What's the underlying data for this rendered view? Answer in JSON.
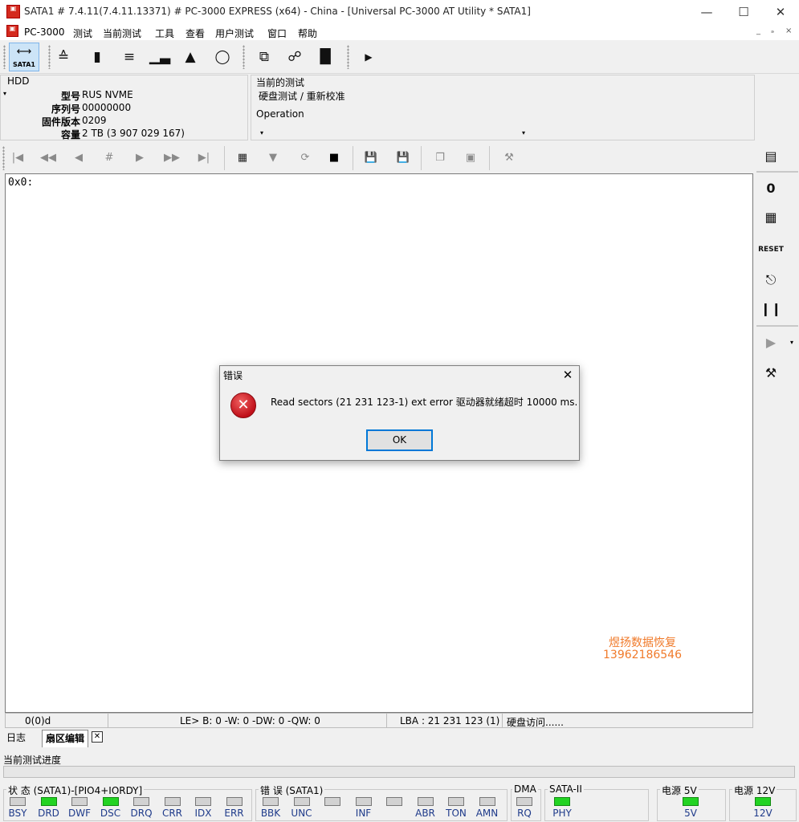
{
  "window": {
    "title": "SATA1 # 7.4.11(7.4.11.13371) # PC-3000 EXPRESS (x64) - China - [Universal PC-3000 AT Utility * SATA1]",
    "minimize": "—",
    "maximize": "☐",
    "close": "✕"
  },
  "menu": {
    "items": [
      "PC-3000",
      "测试",
      "当前测试",
      "工具",
      "查看",
      "用户测试",
      "窗口",
      "帮助"
    ],
    "mdi_min": "_",
    "mdi_restore": "ₔ",
    "mdi_close": "×"
  },
  "toolbar": {
    "sata_label": "SATA1",
    "more": "▶"
  },
  "hdd": {
    "group": "HDD",
    "model_label": "型号",
    "model": "RUS NVME",
    "serial_label": "序列号",
    "serial": "00000000",
    "firmware_label": "固件版本",
    "firmware": "0209",
    "capacity_label": "容量",
    "capacity": "2 TB (3 907 029 167)"
  },
  "current_test": {
    "group": "当前的测试",
    "value": "硬盘测试 / 重新校准",
    "operation_label": "Operation",
    "dropdown_arrow": "▾"
  },
  "editor": {
    "offset_text": "0x0:"
  },
  "watermark": {
    "line1": "煜扬数据恢复",
    "line2": "13962186546"
  },
  "status": {
    "position": "0(0)d",
    "endian": "LE> B: 0 -W: 0 -DW: 0 -QW: 0",
    "lba": "LBA : 21 231 123 (1)",
    "activity": "硬盘访问......"
  },
  "tabs": {
    "log": "日志",
    "sector_editor": "扇区编辑",
    "close": "✕"
  },
  "progress": {
    "label": "当前测试进度",
    "value": 0
  },
  "leds": {
    "status_title": "状 态 (SATA1)-[PIO4+IORDY]",
    "status": [
      {
        "label": "BSY",
        "on": false
      },
      {
        "label": "DRD",
        "on": true
      },
      {
        "label": "DWF",
        "on": false
      },
      {
        "label": "DSC",
        "on": true
      },
      {
        "label": "DRQ",
        "on": false
      },
      {
        "label": "CRR",
        "on": false
      },
      {
        "label": "IDX",
        "on": false
      },
      {
        "label": "ERR",
        "on": false
      }
    ],
    "error_title": "错 误 (SATA1)",
    "error": [
      {
        "label": "BBK",
        "on": false
      },
      {
        "label": "UNC",
        "on": false
      },
      {
        "label": "",
        "on": false
      },
      {
        "label": "INF",
        "on": false
      },
      {
        "label": "",
        "on": false
      },
      {
        "label": "ABR",
        "on": false
      },
      {
        "label": "TON",
        "on": false
      },
      {
        "label": "AMN",
        "on": false
      }
    ],
    "dma_title": "DMA",
    "dma_label": "RQ",
    "sata_title": "SATA-II",
    "sata_label": "PHY",
    "p5_title": "电源 5V",
    "p5_label": "5V",
    "p12_title": "电源 12V",
    "p12_label": "12V"
  },
  "dialog": {
    "title": "错误",
    "close": "✕",
    "message": "Read sectors (21 231 123-1) ext error 驱动器就绪超时 10000 ms.",
    "ok": "OK",
    "icon": "✕"
  },
  "colors": {
    "led_on": "#23d323",
    "led_off": "#d2d2d2",
    "watermark": "#f07a2a",
    "led_label": "#1e3a8a",
    "focus": "#0078d7"
  }
}
